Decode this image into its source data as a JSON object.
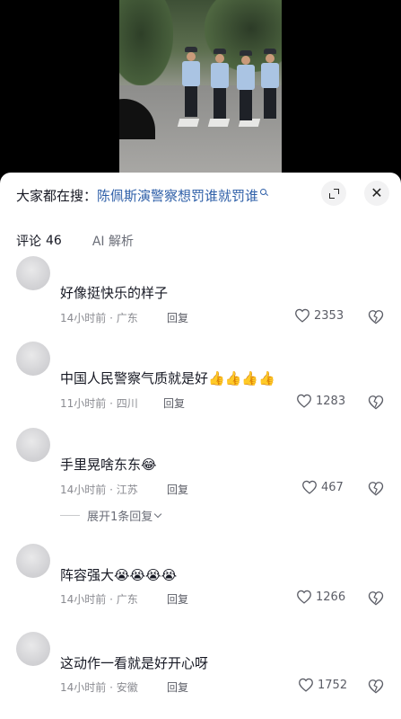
{
  "search": {
    "prefix": "大家都在搜：",
    "term": "陈佩斯演警察想罚谁就罚谁"
  },
  "tabs": [
    {
      "label": "评论",
      "count": "46"
    },
    {
      "label": "AI 解析"
    }
  ],
  "reply_label": "回复",
  "comments": [
    {
      "text": "好像挺快乐的样子",
      "time": "14小时前",
      "location": "广东",
      "likes": "2353"
    },
    {
      "text": "中国人民警察气质就是好👍👍👍👍",
      "time": "11小时前",
      "location": "四川",
      "likes": "1283"
    },
    {
      "text": "手里晃啥东东😂",
      "time": "14小时前",
      "location": "江苏",
      "likes": "467",
      "expand_replies": "展开1条回复"
    },
    {
      "text": "阵容强大😭😭😭😭",
      "time": "14小时前",
      "location": "广东",
      "likes": "1266"
    },
    {
      "text": "这动作一看就是好开心呀",
      "time": "14小时前",
      "location": "安徽",
      "likes": "1752"
    }
  ]
}
